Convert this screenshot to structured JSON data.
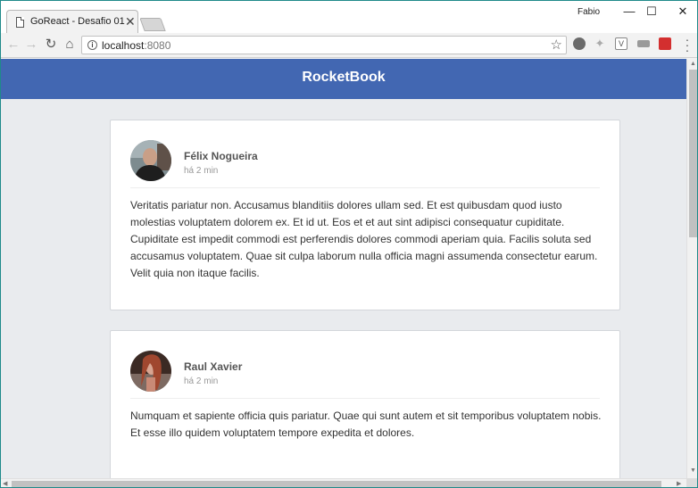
{
  "browser": {
    "tab_title": "GoReact - Desafio 01",
    "tab_close": "✕",
    "profile_name": "Fabio",
    "url_host": "localhost",
    "url_port": ":8080",
    "minimize": "—",
    "maximize": "☐",
    "close": "✕"
  },
  "app": {
    "title": "RocketBook",
    "header_color": "#4267b2",
    "background_color": "#e9ebee"
  },
  "posts": [
    {
      "author": "Félix Nogueira",
      "time": "há 2 min",
      "content": "Veritatis pariatur non. Accusamus blanditiis dolores ullam sed. Et est quibusdam quod iusto molestias voluptatem dolorem ex. Et id ut. Eos et et aut sint adipisci consequatur cupiditate. Cupiditate est impedit commodi est perferendis dolores commodi aperiam quia. Facilis soluta sed accusamus voluptatem. Quae sit culpa laborum nulla officia magni assumenda consectetur earum. Velit quia non itaque facilis."
    },
    {
      "author": "Raul Xavier",
      "time": "há 2 min",
      "content": "Numquam et sapiente officia quis pariatur. Quae qui sunt autem et sit temporibus voluptatem nobis. Et esse illo quidem voluptatem tempore expedita et dolores."
    }
  ]
}
